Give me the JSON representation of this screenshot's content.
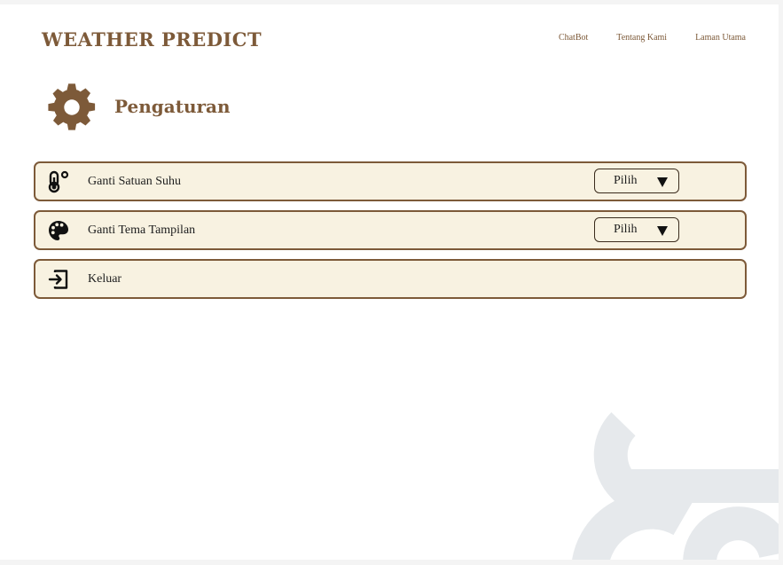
{
  "brand": "WEATHER PREDICT",
  "nav": {
    "chatbot": "ChatBot",
    "about": "Tentang Kami",
    "home": "Laman Utama"
  },
  "settings": {
    "title": "Pengaturan",
    "icon": "gear-icon"
  },
  "rows": [
    {
      "label": "Ganti Satuan Suhu",
      "icon": "thermometer-icon",
      "select": "Pilih"
    },
    {
      "label": "Ganti Tema Tampilan",
      "icon": "palette-icon",
      "select": "Pilih"
    },
    {
      "label": "Keluar",
      "icon": "logout-icon"
    }
  ],
  "colors": {
    "brand": "#7d5a39",
    "row_bg": "#f8f2e1",
    "deco": "#e6e9ec"
  }
}
